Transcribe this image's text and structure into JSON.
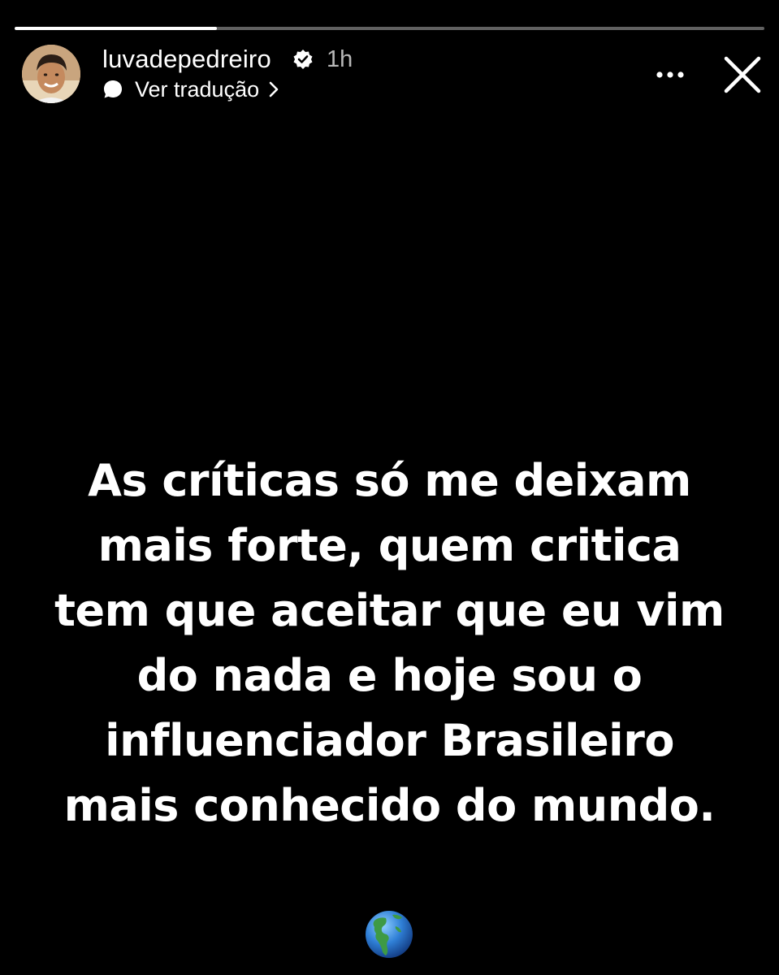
{
  "story": {
    "progress": 0.27,
    "username": "luvadepedreiro",
    "verified": true,
    "time_ago": "1h",
    "translate_label": "Ver tradução",
    "text": "As críticas só me deixam mais forte, quem critica tem que aceitar que eu vim do nada e hoje sou o influenciador Brasileiro mais conhecido do mundo.",
    "emoji": "globe-americas"
  },
  "icons": {
    "verified": "verified-badge-icon",
    "translate": "chat-bubble-icon",
    "chevron": "chevron-right-icon",
    "more": "more-horizontal-icon",
    "close": "close-icon"
  },
  "colors": {
    "background": "#000000",
    "text": "#ffffff",
    "progress_track": "#5f5f5f",
    "globe_ocean": "#2f7fd6",
    "globe_land": "#3e9a45"
  }
}
